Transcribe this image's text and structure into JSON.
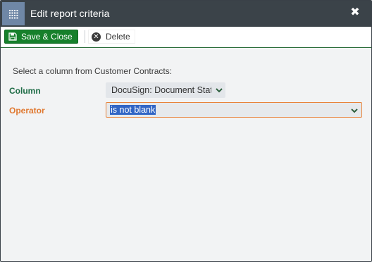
{
  "dialog": {
    "title": "Edit report criteria",
    "title_icon": "grid-icon",
    "close_glyph": "✖"
  },
  "toolbar": {
    "save_label": "Save & Close",
    "save_icon": "floppy-disk-icon",
    "delete_label": "Delete",
    "delete_icon": "x-circle-icon",
    "delete_glyph": "✕"
  },
  "form": {
    "instruction": "Select a column from Customer Contracts:",
    "column": {
      "label": "Column",
      "value": "DocuSign: Document Status"
    },
    "operator": {
      "label": "Operator",
      "value": "is not blank"
    }
  },
  "colors": {
    "titlebar": "#3b4349",
    "title_icon_bg": "#6f87a6",
    "save_button": "#16802b",
    "column_label": "#1d6b45",
    "operator_label": "#e0772e",
    "selection_highlight": "#3165c5"
  }
}
